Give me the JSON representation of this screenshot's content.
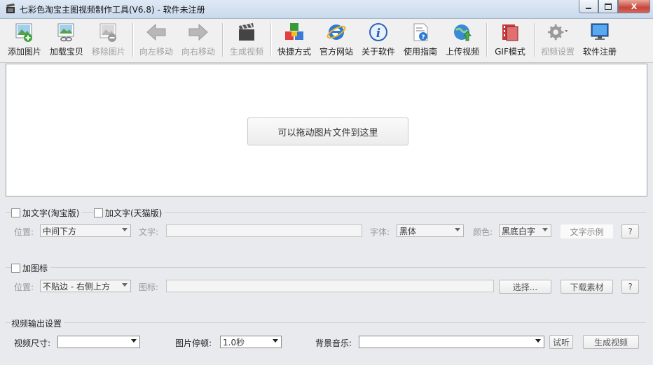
{
  "window": {
    "title": "七彩色淘宝主图视频制作工具(V6.8) - 软件未注册",
    "min_icon": "minimize-icon",
    "max_icon": "maximize-icon",
    "close_label": "X"
  },
  "toolbar": {
    "add_image": "添加图片",
    "load_item": "加载宝贝",
    "remove_image": "移除图片",
    "move_left": "向左移动",
    "move_right": "向右移动",
    "generate_video": "生成视频",
    "shortcut": "快捷方式",
    "website": "官方网站",
    "about": "关于软件",
    "guide": "使用指南",
    "upload_video": "上传视频",
    "gif_mode": "GIF模式",
    "video_settings": "视频设置",
    "register": "软件注册"
  },
  "canvas": {
    "drop_hint": "可以拖动图片文件到这里"
  },
  "text_section": {
    "taobao_check": "加文字(淘宝版)",
    "tmall_check": "加文字(天猫版)",
    "position_label": "位置:",
    "position_value": "中间下方",
    "text_label": "文字:",
    "font_label": "字体:",
    "font_value": "黑体",
    "color_label": "颜色:",
    "color_value": "黑底白字",
    "sample_button": "文字示例",
    "help": "?"
  },
  "icon_section": {
    "check": "加图标",
    "position_label": "位置:",
    "position_value": "不贴边 - 右侧上方",
    "icon_label": "图标:",
    "choose_button": "选择...",
    "download_button": "下载素材",
    "help": "?"
  },
  "output_section": {
    "heading": "视频输出设置",
    "size_label": "视频尺寸:",
    "pause_label": "图片停顿:",
    "pause_value": "1.0秒",
    "music_label": "背景音乐:",
    "listen_button": "试听",
    "generate_button": "生成视频"
  },
  "colors": {
    "accent_blue": "#2a7bd6",
    "disabled_text": "#a0a0a0"
  }
}
